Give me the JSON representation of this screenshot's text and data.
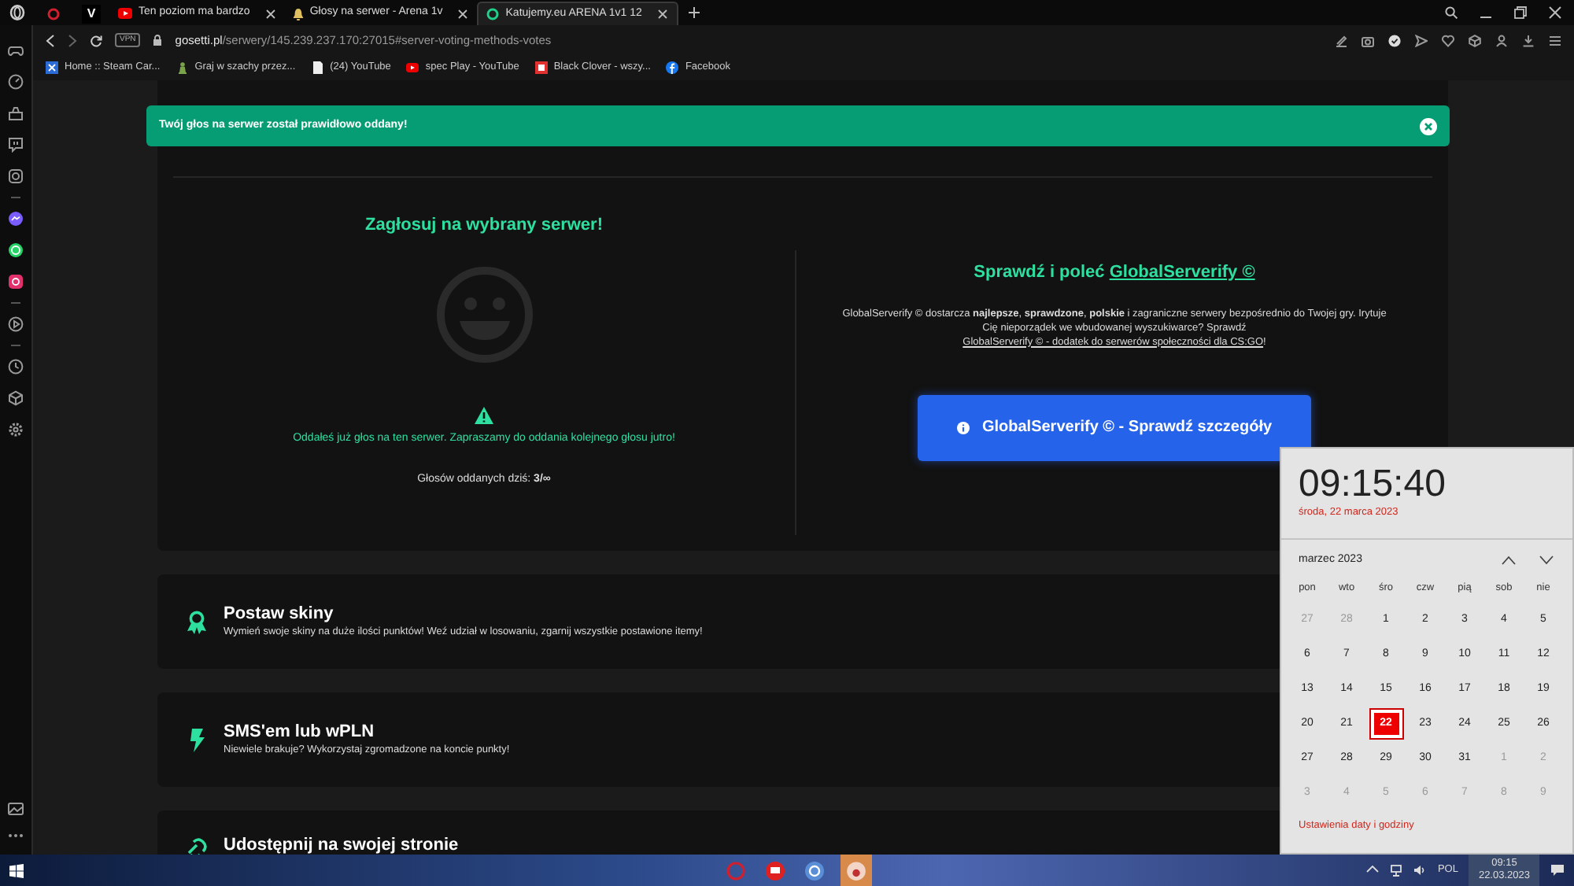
{
  "browser": {
    "tabs": [
      {
        "kind": "pinned",
        "selected": false
      },
      {
        "kind": "pinned",
        "label": "V",
        "selected": false
      },
      {
        "kind": "page",
        "label": "Ten poziom ma bardzo",
        "selected": false
      },
      {
        "kind": "page",
        "label": "Głosy na serwer - Arena 1v",
        "selected": false
      },
      {
        "kind": "page",
        "label": "Katujemy.eu ARENA 1v1 12",
        "selected": true
      }
    ],
    "vpn": "VPN",
    "address": "**gosetti.pl**/serwery/145.239.237.170:27015#server-voting-methods-votes",
    "bookmarks": [
      "Home :: Steam Car...",
      "Graj w szachy przez...",
      "(24) YouTube",
      "spec Play - YouTube",
      "Black Clover - wszy...",
      "Facebook"
    ]
  },
  "toast": {
    "message": "Twój głos na serwer został prawidłowo oddany!"
  },
  "vote": {
    "title": "Zagłosuj na wybrany serwer!",
    "notice": "Oddałeś już głos na ten serwer. Zapraszamy do oddania kolejnego głosu jutro!",
    "count": "Głosów oddanych dziś: **3/∞**"
  },
  "promo": {
    "title": "Sprawdź i poleć",
    "title_link": "GlobalServerify ©",
    "text": "GlobalServerify © dostarcza **najlepsze**, **sprawdzone**, **polskie** i zagraniczne serwery bezpośrednio do Twojej gry. Irytuje Cię nieporządek we wbudowanej wyszukiwarce? Sprawdź",
    "link": "GlobalServerify © - dodatek do serwerów społeczności dla CS:GO",
    "text_end": "!",
    "button": "GlobalServerify © - Sprawdź szczegóły"
  },
  "features": [
    {
      "kind": "award",
      "title": "Postaw skiny",
      "text": "Wymień swoje skiny na duże ilości punktów! Weź udział w losowaniu, zgarnij wszystkie postawione itemy!"
    },
    {
      "kind": "bolt",
      "title": "SMS'em lub wPLN",
      "text": "Niewiele brakuje? Wykorzystaj zgromadzone na koncie punkty!"
    },
    {
      "kind": "share",
      "title": "Udostępnij na swojej stronie"
    }
  ],
  "clock": {
    "time": "09:15:40",
    "date": "środa, 22 marca 2023",
    "month": "marzec 2023",
    "weekdays": [
      "pon",
      "wto",
      "śro",
      "czw",
      "pią",
      "sob",
      "nie"
    ],
    "days": [
      {
        "label": "27",
        "muted": true,
        "selected": false
      },
      {
        "label": "28",
        "muted": true,
        "selected": false
      },
      {
        "label": "1",
        "muted": false,
        "selected": false
      },
      {
        "label": "2",
        "muted": false,
        "selected": false
      },
      {
        "label": "3",
        "muted": false,
        "selected": false
      },
      {
        "label": "4",
        "muted": false,
        "selected": false
      },
      {
        "label": "5",
        "muted": false,
        "selected": false
      },
      {
        "label": "6",
        "muted": false,
        "selected": false
      },
      {
        "label": "7",
        "muted": false,
        "selected": false
      },
      {
        "label": "8",
        "muted": false,
        "selected": false
      },
      {
        "label": "9",
        "muted": false,
        "selected": false
      },
      {
        "label": "10",
        "muted": false,
        "selected": false
      },
      {
        "label": "11",
        "muted": false,
        "selected": false
      },
      {
        "label": "12",
        "muted": false,
        "selected": false
      },
      {
        "label": "13",
        "muted": false,
        "selected": false
      },
      {
        "label": "14",
        "muted": false,
        "selected": false
      },
      {
        "label": "15",
        "muted": false,
        "selected": false
      },
      {
        "label": "16",
        "muted": false,
        "selected": false
      },
      {
        "label": "17",
        "muted": false,
        "selected": false
      },
      {
        "label": "18",
        "muted": false,
        "selected": false
      },
      {
        "label": "19",
        "muted": false,
        "selected": false
      },
      {
        "label": "20",
        "muted": false,
        "selected": false
      },
      {
        "label": "21",
        "muted": false,
        "selected": false
      },
      {
        "label": "22",
        "muted": false,
        "selected": true
      },
      {
        "label": "23",
        "muted": false,
        "selected": false
      },
      {
        "label": "24",
        "muted": false,
        "selected": false
      },
      {
        "label": "25",
        "muted": false,
        "selected": false
      },
      {
        "label": "26",
        "muted": false,
        "selected": false
      },
      {
        "label": "27",
        "muted": false,
        "selected": false
      },
      {
        "label": "28",
        "muted": false,
        "selected": false
      },
      {
        "label": "29",
        "muted": false,
        "selected": false
      },
      {
        "label": "30",
        "muted": false,
        "selected": false
      },
      {
        "label": "31",
        "muted": false,
        "selected": false
      },
      {
        "label": "1",
        "muted": true,
        "selected": false
      },
      {
        "label": "2",
        "muted": true,
        "selected": false
      },
      {
        "label": "3",
        "muted": true,
        "selected": false
      },
      {
        "label": "4",
        "muted": true,
        "selected": false
      },
      {
        "label": "5",
        "muted": true,
        "selected": false
      },
      {
        "label": "6",
        "muted": true,
        "selected": false
      },
      {
        "label": "7",
        "muted": true,
        "selected": false
      },
      {
        "label": "8",
        "muted": true,
        "selected": false
      },
      {
        "label": "9",
        "muted": true,
        "selected": false
      }
    ],
    "settings_link": "Ustawienia daty i godziny"
  },
  "taskbar": {
    "language": "POL",
    "time": "09:15",
    "date": "22.03.2023"
  }
}
